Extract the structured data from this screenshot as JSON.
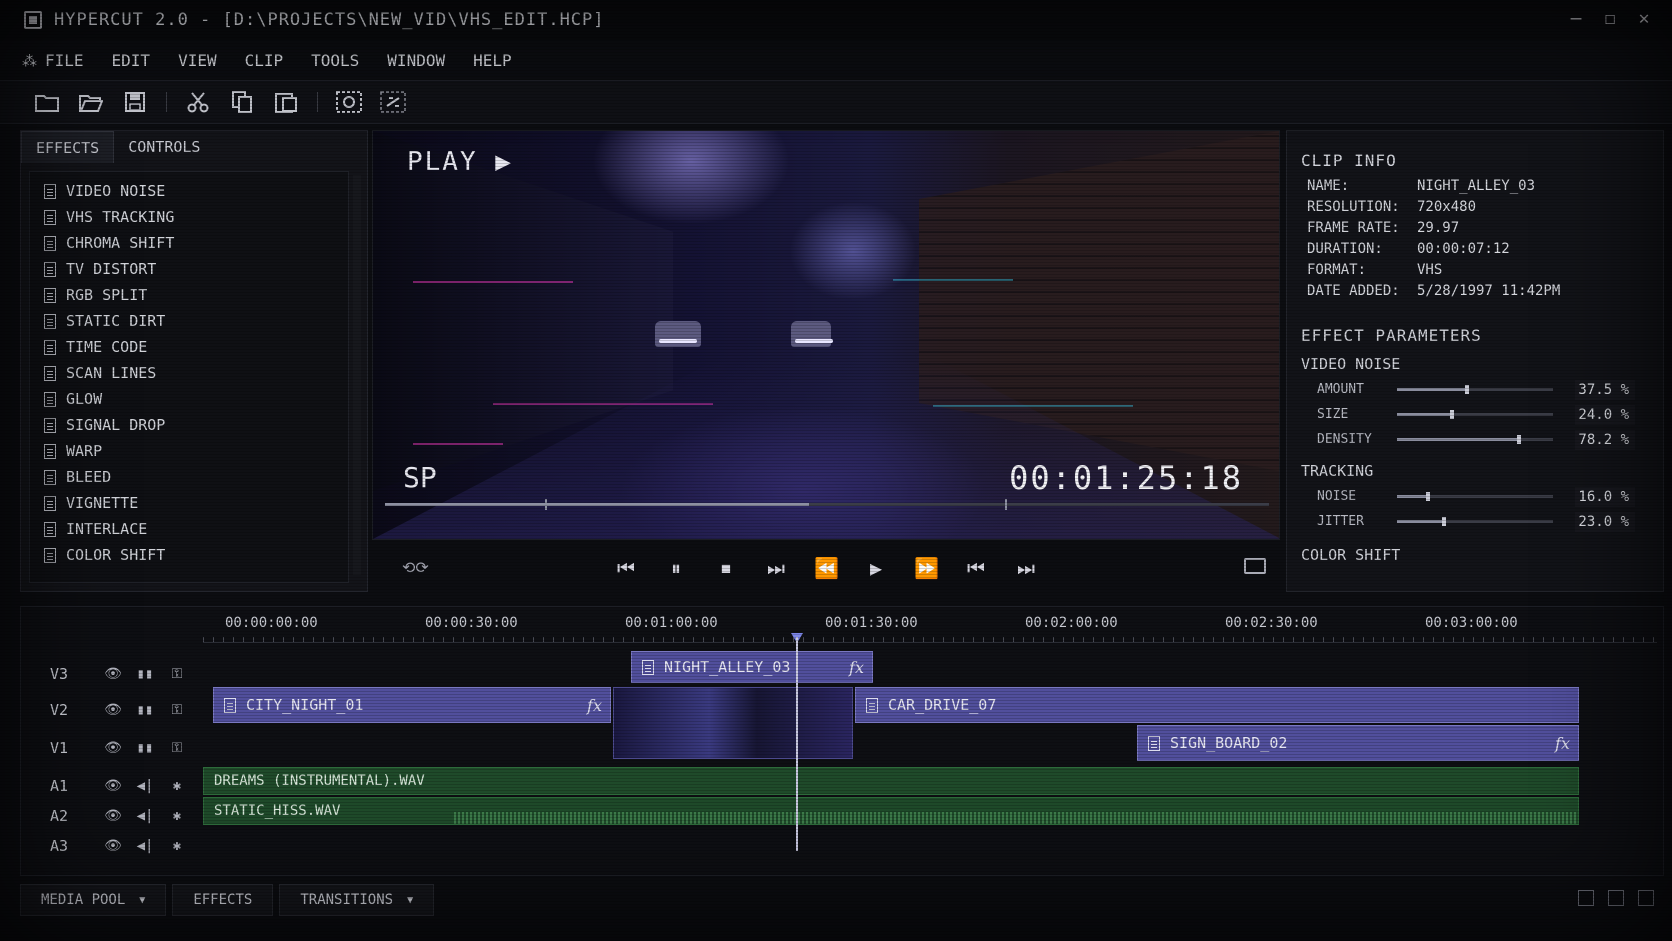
{
  "window": {
    "title": "HYPERCUT 2.0 - [D:\\PROJECTS\\NEW_VID\\VHS_EDIT.HCP]",
    "controls": [
      "—",
      "☐",
      "✕"
    ]
  },
  "menu": [
    "FILE",
    "EDIT",
    "VIEW",
    "CLIP",
    "TOOLS",
    "WINDOW",
    "HELP"
  ],
  "toolbar": [
    "new-folder-icon",
    "open-folder-icon",
    "save-icon",
    "cut-icon",
    "copy-icon",
    "paste-icon",
    "snapshot-icon",
    "link-icon"
  ],
  "left_panel": {
    "tabs": [
      "EFFECTS",
      "CONTROLS"
    ],
    "effects": [
      "VIDEO NOISE",
      "VHS TRACKING",
      "CHROMA SHIFT",
      "TV DISTORT",
      "RGB SPLIT",
      "STATIC DIRT",
      "TIME CODE",
      "SCAN LINES",
      "GLOW",
      "SIGNAL DROP",
      "WARP",
      "BLEED",
      "VIGNETTE",
      "INTERLACE",
      "COLOR SHIFT"
    ]
  },
  "viewer": {
    "play_label": "PLAY ▶",
    "mode": "SP",
    "timecode": "00:01:25:18",
    "progress": 0.48
  },
  "transport": [
    "⏮",
    "⏸",
    "⏹",
    "⏭",
    "⏪",
    "▶",
    "⏩",
    "⏮",
    "⏭"
  ],
  "clip_info": {
    "heading": "CLIP INFO",
    "rows": [
      {
        "key": "NAME:",
        "value": "NIGHT_ALLEY_03"
      },
      {
        "key": "RESOLUTION:",
        "value": "720x480"
      },
      {
        "key": "FRAME RATE:",
        "value": "29.97"
      },
      {
        "key": "DURATION:",
        "value": "00:00:07:12"
      },
      {
        "key": "FORMAT:",
        "value": "VHS"
      },
      {
        "key": "DATE ADDED:",
        "value": "5/28/1997 11:42PM"
      }
    ]
  },
  "effect_params": {
    "heading": "EFFECT PARAMETERS",
    "groups": [
      {
        "name": "VIDEO NOISE",
        "params": [
          {
            "label": "AMOUNT",
            "value": "37.5 %",
            "level": 0.45
          },
          {
            "label": "SIZE",
            "value": "24.0 %",
            "level": 0.35
          },
          {
            "label": "DENSITY",
            "value": "78.2 %",
            "level": 0.78
          }
        ]
      },
      {
        "name": "TRACKING",
        "params": [
          {
            "label": "NOISE",
            "value": "16.0 %",
            "level": 0.2
          },
          {
            "label": "JITTER",
            "value": "23.0 %",
            "level": 0.3
          }
        ]
      },
      {
        "name": "COLOR SHIFT",
        "params": []
      }
    ]
  },
  "timeline": {
    "ruler": [
      "00:00:00:00",
      "00:00:30:00",
      "00:01:00:00",
      "00:01:30:00",
      "00:02:00:00",
      "00:02:30:00",
      "00:03:00:00"
    ],
    "tracks": [
      "V3",
      "V2",
      "V1",
      "A1",
      "A2",
      "A3"
    ],
    "clips": {
      "v3": "NIGHT_ALLEY_03",
      "v2a": "CITY_NIGHT_01",
      "v2b": "CAR_DRIVE_07",
      "v1": "SIGN_BOARD_02",
      "a1": "DREAMS (INSTRUMENTAL).WAV",
      "a2": "STATIC_HISS.WAV"
    },
    "fx_label": "fx"
  },
  "bottom_tabs": [
    "MEDIA POOL",
    "EFFECTS",
    "TRANSITIONS"
  ]
}
